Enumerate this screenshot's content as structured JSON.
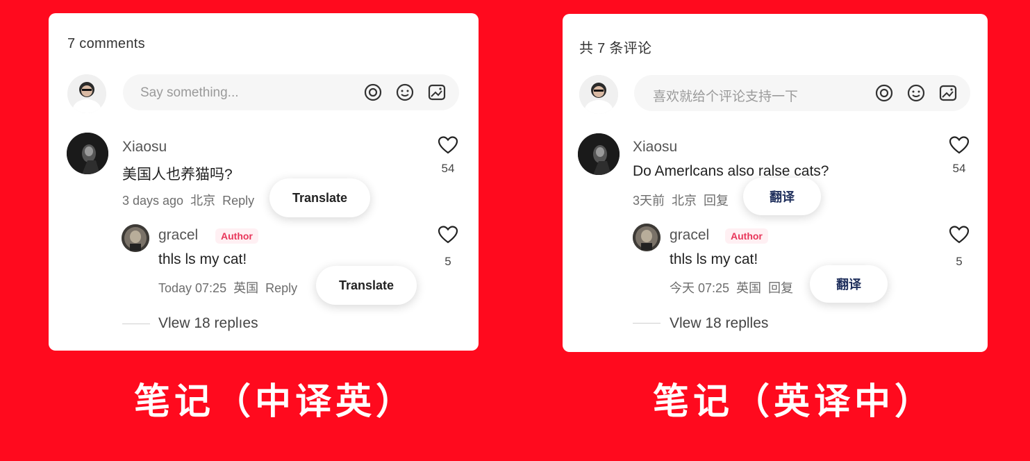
{
  "left": {
    "count": "7 comments",
    "input_placeholder": "Say something...",
    "comment": {
      "author": "Xiaosu",
      "text": "美国人也养猫吗?",
      "meta_time": "3 days ago",
      "meta_location": "北京",
      "meta_reply": "Reply",
      "translate": "Translate",
      "likes": "54"
    },
    "reply": {
      "author": "gracel",
      "badge": "Author",
      "text": "thls ls my cat!",
      "meta_time": "Today 07:25",
      "meta_location": "英国",
      "meta_reply": "Reply",
      "translate": "Translate",
      "likes": "5"
    },
    "view_replies": "Vlew 18 replıes"
  },
  "right": {
    "count": "共 7 条评论",
    "input_placeholder": "喜欢就给个评论支持一下",
    "comment": {
      "author": "Xiaosu",
      "text": "Do Amerlcans also ralse cats?",
      "meta_time": "3天前",
      "meta_location": "北京",
      "meta_reply": "回复",
      "translate": "翻译",
      "likes": "54"
    },
    "reply": {
      "author": "gracel",
      "badge": "Author",
      "text": "thls ls my cat!",
      "meta_time": "今天 07:25",
      "meta_location": "英国",
      "meta_reply": "回复",
      "translate": "翻译",
      "likes": "5"
    },
    "view_replies": "Vlew 18 replles"
  },
  "captions": {
    "left": "笔记（中译英）",
    "right": "笔记（英译中）"
  },
  "icons": [
    "at-icon",
    "emoji-icon",
    "image-icon",
    "heart-icon",
    "user-avatar"
  ],
  "colors": {
    "background": "#ff0a1e",
    "author_badge": "#e8365a"
  }
}
